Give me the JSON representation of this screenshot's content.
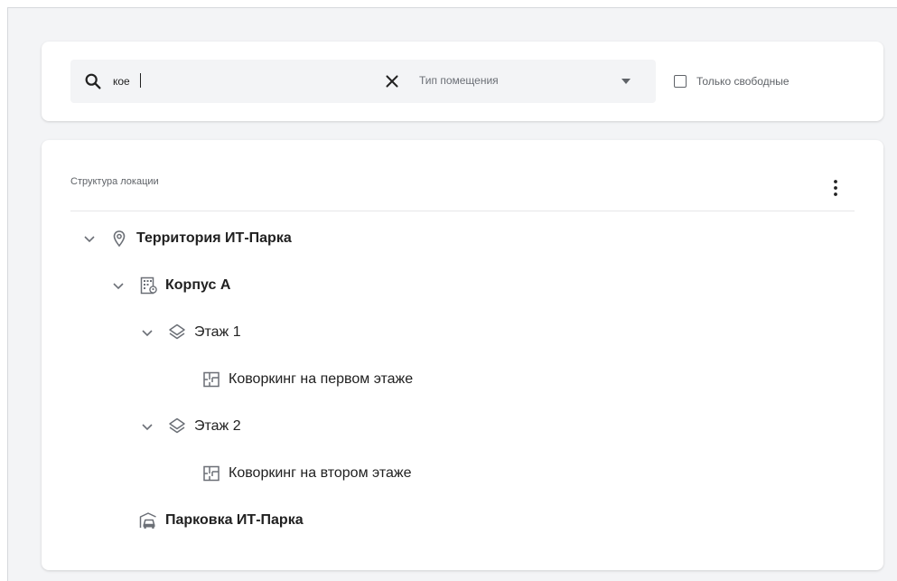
{
  "filters": {
    "search": {
      "value": "кое",
      "icon": "search-icon",
      "clear_icon": "close-icon"
    },
    "room_type": {
      "placeholder": "Тип помещения",
      "icon": "dropdown-arrow-icon"
    },
    "free_only": {
      "label": "Только свободные",
      "checked": false
    }
  },
  "tree": {
    "header": "Структура локации",
    "menu_icon": "more-vertical-icon",
    "nodes": [
      {
        "label": "Территория ИТ-Парка",
        "icon": "location-pin-icon",
        "bold": true,
        "expanded": true,
        "level": 0
      },
      {
        "label": "Корпус А",
        "icon": "building-icon",
        "bold": true,
        "expanded": true,
        "level": 1
      },
      {
        "label": "Этаж 1",
        "icon": "layers-icon",
        "bold": false,
        "expanded": true,
        "level": 2
      },
      {
        "label": "Коворкинг на первом этаже",
        "icon": "floor-plan-icon",
        "bold": false,
        "level": 3
      },
      {
        "label": "Этаж 2",
        "icon": "layers-icon",
        "bold": false,
        "expanded": true,
        "level": 2
      },
      {
        "label": "Коворкинг на втором этаже",
        "icon": "floor-plan-icon",
        "bold": false,
        "level": 3
      },
      {
        "label": "Парковка ИТ-Парка",
        "icon": "parking-car-icon",
        "bold": true,
        "level": 1
      }
    ]
  },
  "colors": {
    "background": "#f3f4f6",
    "card": "#ffffff",
    "text": "#212121",
    "muted": "#5f6368",
    "icon": "#6b6f76"
  }
}
